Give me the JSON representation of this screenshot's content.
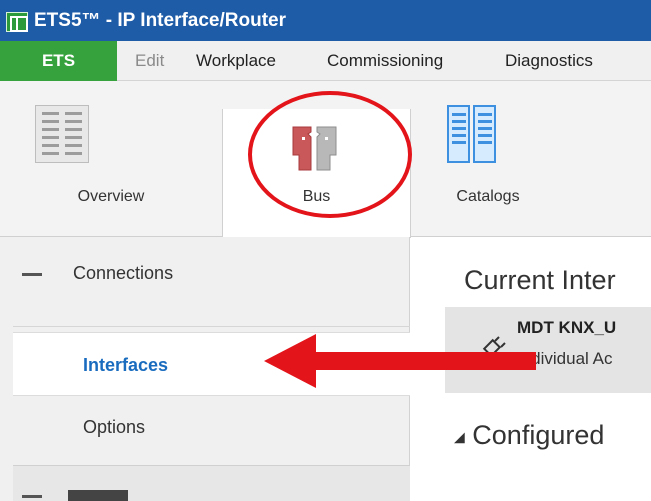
{
  "window": {
    "title": "ETS5™ - IP Interface/Router"
  },
  "menubar": {
    "ets_tab": "ETS",
    "items": [
      {
        "label": "Edit",
        "disabled": true
      },
      {
        "label": "Workplace",
        "disabled": false
      },
      {
        "label": "Commissioning",
        "disabled": false
      },
      {
        "label": "Diagnostics",
        "disabled": false
      }
    ]
  },
  "ribbon": {
    "tabs": [
      {
        "label": "Overview",
        "icon": "overview-icon"
      },
      {
        "label": "Bus",
        "icon": "bus-icon",
        "active": true
      },
      {
        "label": "Catalogs",
        "icon": "catalogs-icon"
      }
    ]
  },
  "sidebar": {
    "section": {
      "label": "Connections",
      "icon": "collapse-minus-icon"
    },
    "items": [
      {
        "label": "Interfaces",
        "selected": true
      },
      {
        "label": "Options",
        "selected": false
      }
    ]
  },
  "content": {
    "current_heading": "Current Inter",
    "interface": {
      "name": "MDT KNX_U",
      "address": "Individual Ac",
      "icon": "usb-plug-icon"
    },
    "configured_heading": "Configured"
  },
  "annotations": {
    "circle_color": "#e3141a",
    "arrow_color": "#e3141a"
  }
}
